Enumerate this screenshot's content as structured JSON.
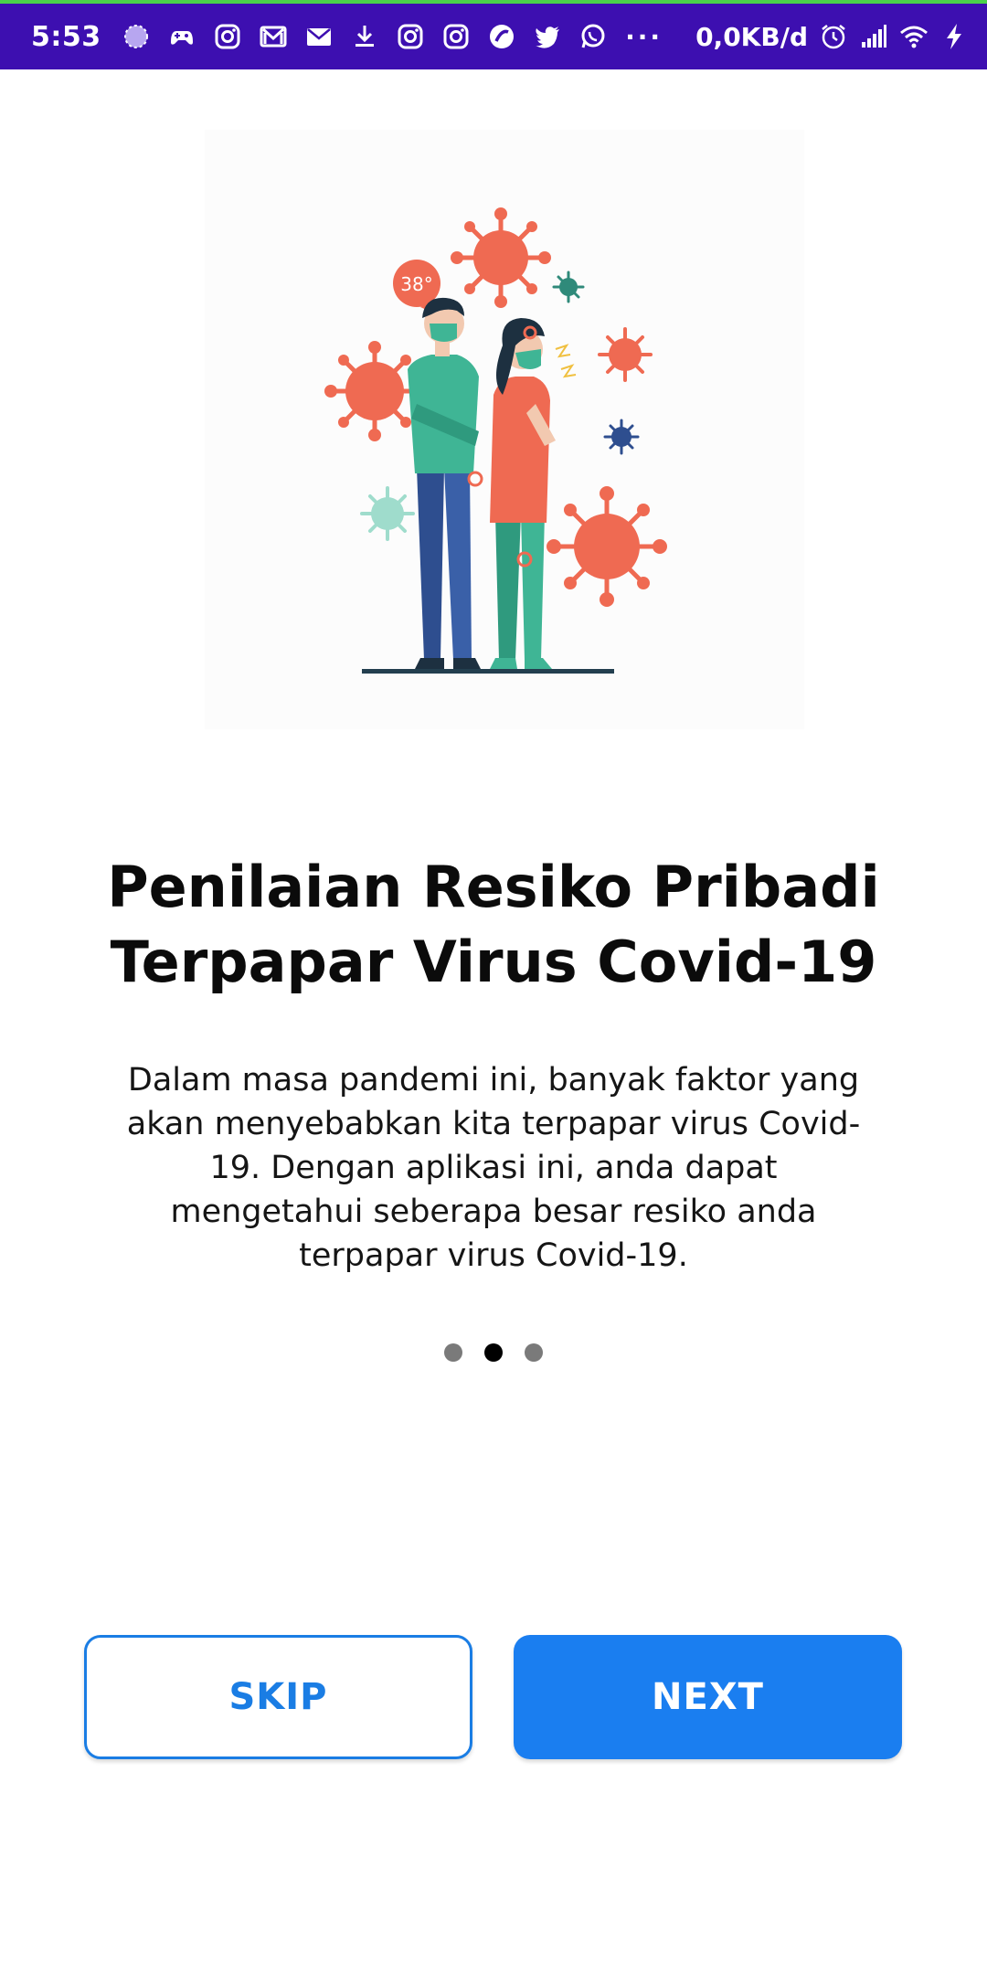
{
  "status_bar": {
    "time": "5:53",
    "overflow_label": "···",
    "network_speed": "0,0KB/d",
    "notification_icons": [
      "sync-icon",
      "game-controller-icon",
      "instagram-icon",
      "gmail-icon",
      "mail-icon",
      "download-icon",
      "instagram-icon",
      "instagram-icon",
      "app-icon",
      "twitter-icon",
      "whatsapp-icon"
    ],
    "system_icons": [
      "alarm-icon",
      "signal-icon",
      "wifi-icon",
      "charging-icon"
    ],
    "colors": {
      "background": "#3d0fb0",
      "top_accent": "#4ad24a"
    }
  },
  "onboarding": {
    "illustration_icon": "covid-people-illustration",
    "illustration_badge": "38°",
    "title": "Penilaian Resiko Pribadi\nTerpapar Virus Covid-19",
    "description": "Dalam masa pandemi ini, banyak faktor yang akan menyebabkan kita terpapar virus Covid-19. Dengan aplikasi ini, anda dapat mengetahui seberapa besar resiko anda terpapar virus Covid-19.",
    "page_count": 3,
    "current_page": 2
  },
  "buttons": {
    "skip_label": "SKIP",
    "next_label": "NEXT"
  },
  "colors": {
    "accent": "#1a7ef0",
    "title_text": "#0b0b0b",
    "dot_active": "#000000",
    "dot_inactive": "#7a7a7a"
  }
}
